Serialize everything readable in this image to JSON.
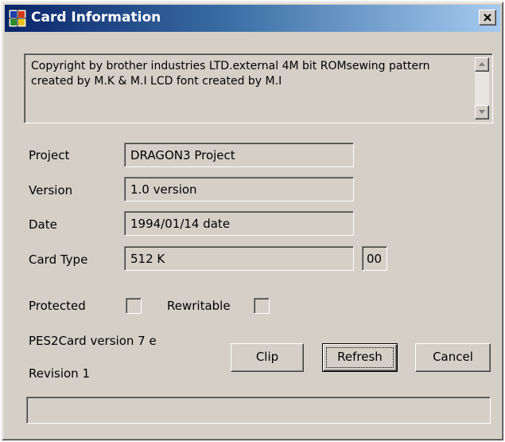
{
  "window": {
    "title": "Card Information",
    "icon": "grid-app-icon",
    "close_label": "close-icon"
  },
  "info": {
    "text": "Copyright  by brother industries LTD.external 4M bit  ROMsewing pattern created by M.K & M.I  LCD font created by M.I"
  },
  "fields": {
    "project": {
      "label": "Project",
      "value": "DRAGON3 Project"
    },
    "version": {
      "label": "Version",
      "value": "1.0   version"
    },
    "date": {
      "label": "Date",
      "value": "1994/01/14 date"
    },
    "card_type": {
      "label": "Card Type",
      "value": "512 K",
      "code": "00"
    }
  },
  "flags": {
    "protected": {
      "label": "Protected",
      "checked": false
    },
    "rewritable": {
      "label": "Rewritable",
      "checked": false
    }
  },
  "footer": {
    "app_version": "PES2Card version 7 e",
    "revision": "Revision   1"
  },
  "buttons": {
    "clip": "Clip",
    "refresh": "Refresh",
    "cancel": "Cancel"
  },
  "status": {
    "text": ""
  },
  "colors": {
    "face": "#d4d0c8",
    "title_start": "#0a246a",
    "title_end": "#a6caf0",
    "title_text": "#ffffff"
  }
}
